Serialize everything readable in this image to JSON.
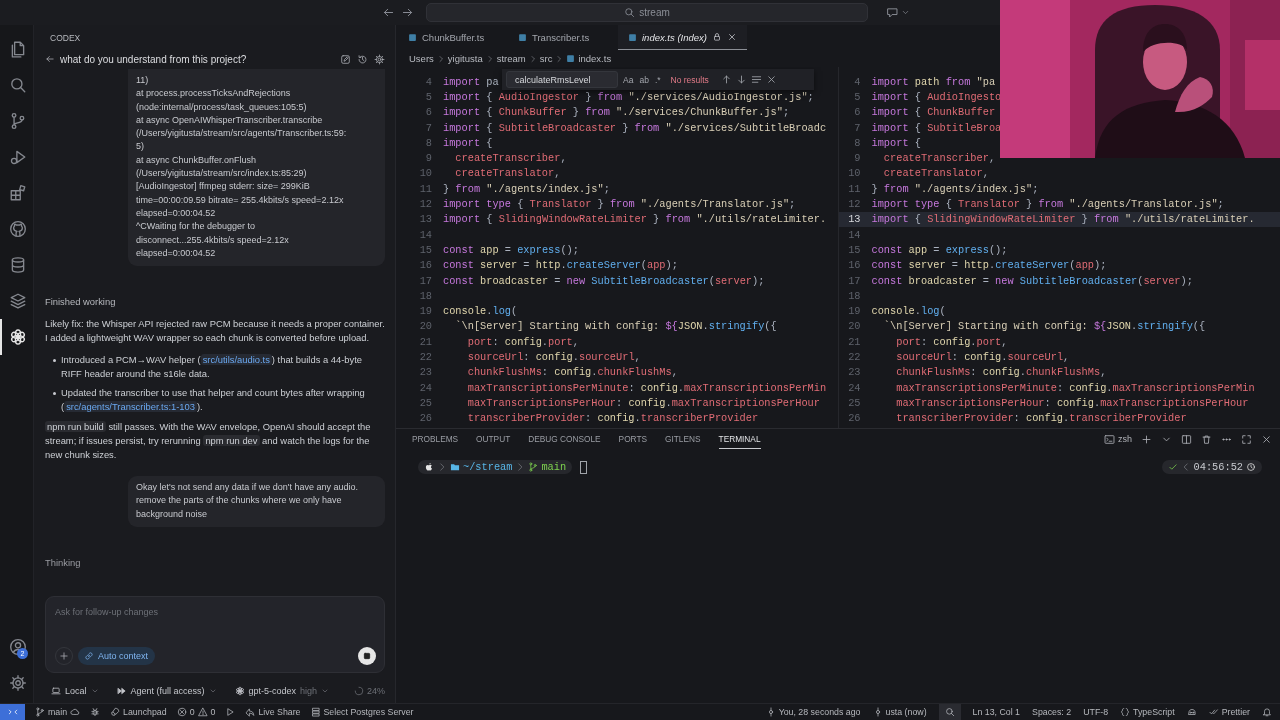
{
  "title_bar": {
    "search": "stream"
  },
  "activity_bar": {
    "items": [
      {
        "kind": "files",
        "selected": false
      },
      {
        "kind": "search",
        "selected": false
      },
      {
        "kind": "scm",
        "selected": false
      },
      {
        "kind": "run",
        "selected": false
      },
      {
        "kind": "extensions",
        "selected": false
      },
      {
        "kind": "github",
        "selected": false
      },
      {
        "kind": "database",
        "selected": false
      },
      {
        "kind": "layers",
        "selected": false
      },
      {
        "kind": "codex",
        "selected": true
      }
    ],
    "account_badge": "2"
  },
  "codex": {
    "heading": "CODEX",
    "thread_title": "what do you understand from this project?",
    "messages": [
      {
        "kind": "user",
        "text": "11)\nat process.processTicksAndRejections\n(node:internal/process/task_queues:105:5)\nat async OpenAIWhisperTranscriber.transcribe\n(/Users/yigitusta/stream/src/agents/Transcriber.ts:59:\n5)\nat async ChunkBuffer.onFlush\n(/Users/yigitusta/stream/src/index.ts:85:29)\n[AudioIngestor] ffmpeg stderr: size= 299KiB\ntime=00:00:09.59 bitrate= 255.4kbits/s speed=2.12x\nelapsed=0:00:04.52\n^CWaiting for the debugger to\ndisconnect...255.4kbits/s speed=2.12x\nelapsed=0:00:04.52"
      },
      {
        "kind": "status",
        "text": "Finished working"
      },
      {
        "kind": "paragraph",
        "segments": [
          {
            "kind": "text",
            "text": "Likely fix: the Whisper API rejected raw PCM because it needs a proper container. I added a lightweight WAV wrapper so each chunk is converted before upload."
          }
        ]
      },
      {
        "kind": "bullets",
        "items": [
          {
            "segments": [
              {
                "kind": "text",
                "text": "Introduced a PCM→WAV helper ("
              },
              {
                "kind": "link",
                "text": "src/utils/audio.ts"
              },
              {
                "kind": "text",
                "text": ") that builds a 44-byte RIFF header around the s16le data."
              }
            ]
          },
          {
            "segments": [
              {
                "kind": "text",
                "text": "Updated the transcriber to use that helper and count bytes after wrapping ("
              },
              {
                "kind": "link",
                "text": "src/agents/Transcriber.ts:1-103"
              },
              {
                "kind": "text",
                "text": ")."
              }
            ]
          }
        ]
      },
      {
        "kind": "paragraph",
        "segments": [
          {
            "kind": "code",
            "text": "npm run build"
          },
          {
            "kind": "text",
            "text": " still passes. With the WAV envelope, OpenAI should accept the stream; if issues persist, try rerunning "
          },
          {
            "kind": "code",
            "text": "npm run dev"
          },
          {
            "kind": "text",
            "text": " and watch the logs for the new chunk sizes."
          }
        ]
      },
      {
        "kind": "user",
        "text": "Okay let's not send any data if we don't have any audio. remove the parts of the chunks where we only have background noise"
      },
      {
        "kind": "thinking",
        "text": "Thinking"
      }
    ],
    "composer": {
      "placeholder": "Ask for follow-up changes",
      "chip": "Auto context"
    },
    "footer": {
      "environment": "Local",
      "mode": "Agent (full access)",
      "model": "gpt-5-codex",
      "effort": "high",
      "usage": "24%"
    }
  },
  "editor": {
    "tabs": [
      {
        "label": "ChunkBuffer.ts",
        "selected": false,
        "preview": false,
        "locked": false
      },
      {
        "label": "Transcriber.ts",
        "selected": false,
        "preview": false,
        "locked": false
      },
      {
        "label": "index.ts (Index)",
        "selected": true,
        "preview": true,
        "locked": true
      }
    ],
    "breadcrumbs": [
      "Users",
      "yigitusta",
      "stream",
      "src",
      "index.ts"
    ],
    "find": {
      "value": "calculateRmsLevel",
      "toggles": [
        "Aa",
        "ab",
        ".*"
      ],
      "result": "No results"
    },
    "panes": [
      {
        "lines": [
          {
            "n": "4",
            "current": false,
            "tokens": [
              {
                "kind": "keyword",
                "text": "import"
              },
              {
                "kind": "plain",
                "text": " pa"
              }
            ]
          },
          {
            "n": "5",
            "current": false,
            "tokens": [
              {
                "kind": "keyword",
                "text": "import"
              },
              {
                "kind": "plain",
                "text": " { "
              },
              {
                "kind": "type",
                "text": "AudioIngestor"
              },
              {
                "kind": "plain",
                "text": " } "
              },
              {
                "kind": "keyword",
                "text": "from"
              },
              {
                "kind": "string",
                "text": " \"./services/AudioIngestor.js\""
              },
              {
                "kind": "plain",
                "text": ";"
              }
            ]
          },
          {
            "n": "6",
            "current": false,
            "tokens": [
              {
                "kind": "keyword",
                "text": "import"
              },
              {
                "kind": "plain",
                "text": " { "
              },
              {
                "kind": "type",
                "text": "ChunkBuffer"
              },
              {
                "kind": "plain",
                "text": " } "
              },
              {
                "kind": "keyword",
                "text": "from"
              },
              {
                "kind": "string",
                "text": " \"./services/ChunkBuffer.js\""
              },
              {
                "kind": "plain",
                "text": ";"
              }
            ]
          },
          {
            "n": "7",
            "current": false,
            "tokens": [
              {
                "kind": "keyword",
                "text": "import"
              },
              {
                "kind": "plain",
                "text": " { "
              },
              {
                "kind": "type",
                "text": "SubtitleBroadcaster"
              },
              {
                "kind": "plain",
                "text": " } "
              },
              {
                "kind": "keyword",
                "text": "from"
              },
              {
                "kind": "string",
                "text": " \"./services/SubtitleBroadc"
              }
            ]
          },
          {
            "n": "8",
            "current": false,
            "tokens": [
              {
                "kind": "keyword",
                "text": "import"
              },
              {
                "kind": "plain",
                "text": " {"
              }
            ]
          },
          {
            "n": "9",
            "current": false,
            "kind": "inner",
            "tokens": [
              {
                "kind": "type",
                "text": "createTranscriber"
              },
              {
                "kind": "plain",
                "text": ","
              }
            ]
          },
          {
            "n": "10",
            "current": false,
            "kind": "inner",
            "tokens": [
              {
                "kind": "type",
                "text": "createTranslator"
              },
              {
                "kind": "plain",
                "text": ","
              }
            ]
          },
          {
            "n": "11",
            "current": false,
            "tokens": [
              {
                "kind": "plain",
                "text": "} "
              },
              {
                "kind": "keyword",
                "text": "from"
              },
              {
                "kind": "string",
                "text": " \"./agents/index.js\""
              },
              {
                "kind": "plain",
                "text": ";"
              }
            ]
          },
          {
            "n": "12",
            "current": false,
            "tokens": [
              {
                "kind": "keyword",
                "text": "import type"
              },
              {
                "kind": "plain",
                "text": " { "
              },
              {
                "kind": "type",
                "text": "Translator"
              },
              {
                "kind": "plain",
                "text": " } "
              },
              {
                "kind": "keyword",
                "text": "from"
              },
              {
                "kind": "string",
                "text": " \"./agents/Translator.js\""
              },
              {
                "kind": "plain",
                "text": ";"
              }
            ]
          },
          {
            "n": "13",
            "current": false,
            "tokens": [
              {
                "kind": "keyword",
                "text": "import"
              },
              {
                "kind": "plain",
                "text": " { "
              },
              {
                "kind": "type",
                "text": "SlidingWindowRateLimiter"
              },
              {
                "kind": "plain",
                "text": " } "
              },
              {
                "kind": "keyword",
                "text": "from"
              },
              {
                "kind": "string",
                "text": " \"./utils/rateLimiter."
              }
            ]
          },
          {
            "n": "14",
            "current": false
          },
          {
            "n": "15",
            "current": false,
            "tokens": [
              {
                "kind": "keyword",
                "text": "const"
              },
              {
                "kind": "variable",
                "text": " app"
              },
              {
                "kind": "plain",
                "text": " = "
              },
              {
                "kind": "function",
                "text": "express"
              },
              {
                "kind": "plain",
                "text": "();"
              }
            ]
          },
          {
            "n": "16",
            "current": false,
            "tokens": [
              {
                "kind": "keyword",
                "text": "const"
              },
              {
                "kind": "variable",
                "text": " server"
              },
              {
                "kind": "plain",
                "text": " = "
              },
              {
                "kind": "variable",
                "text": "http"
              },
              {
                "kind": "plain",
                "text": "."
              },
              {
                "kind": "function",
                "text": "createServer"
              },
              {
                "kind": "plain",
                "text": "("
              },
              {
                "kind": "type",
                "text": "app"
              },
              {
                "kind": "plain",
                "text": ");"
              }
            ]
          },
          {
            "n": "17",
            "current": false,
            "tokens": [
              {
                "kind": "keyword",
                "text": "const"
              },
              {
                "kind": "variable",
                "text": " broadcaster"
              },
              {
                "kind": "plain",
                "text": " = "
              },
              {
                "kind": "keyword",
                "text": "new"
              },
              {
                "kind": "function",
                "text": " SubtitleBroadcaster"
              },
              {
                "kind": "plain",
                "text": "("
              },
              {
                "kind": "type",
                "text": "server"
              },
              {
                "kind": "plain",
                "text": ");"
              }
            ]
          },
          {
            "n": "18",
            "current": false
          },
          {
            "n": "19",
            "current": false,
            "tokens": [
              {
                "kind": "variable",
                "text": "console"
              },
              {
                "kind": "plain",
                "text": "."
              },
              {
                "kind": "function",
                "text": "log"
              },
              {
                "kind": "plain",
                "text": "("
              }
            ]
          },
          {
            "n": "20",
            "current": false,
            "kind": "inner",
            "tokens": [
              {
                "kind": "string",
                "text": "`\\n[Server] Starting with config:"
              },
              {
                "kind": "keyword",
                "text": " ${"
              },
              {
                "kind": "variable",
                "text": "JSON"
              },
              {
                "kind": "plain",
                "text": "."
              },
              {
                "kind": "function",
                "text": "stringify"
              },
              {
                "kind": "plain",
                "text": "({"
              }
            ]
          },
          {
            "n": "21",
            "current": false,
            "kind": "deeper",
            "tokens": [
              {
                "kind": "type",
                "text": "port"
              },
              {
                "kind": "plain",
                "text": ": "
              },
              {
                "kind": "variable",
                "text": "config"
              },
              {
                "kind": "plain",
                "text": "."
              },
              {
                "kind": "type",
                "text": "port"
              },
              {
                "kind": "plain",
                "text": ","
              }
            ]
          },
          {
            "n": "22",
            "current": false,
            "kind": "deeper",
            "tokens": [
              {
                "kind": "type",
                "text": "sourceUrl"
              },
              {
                "kind": "plain",
                "text": ": "
              },
              {
                "kind": "variable",
                "text": "config"
              },
              {
                "kind": "plain",
                "text": "."
              },
              {
                "kind": "type",
                "text": "sourceUrl"
              },
              {
                "kind": "plain",
                "text": ","
              }
            ]
          },
          {
            "n": "23",
            "current": false,
            "kind": "deeper",
            "tokens": [
              {
                "kind": "type",
                "text": "chunkFlushMs"
              },
              {
                "kind": "plain",
                "text": ": "
              },
              {
                "kind": "variable",
                "text": "config"
              },
              {
                "kind": "plain",
                "text": "."
              },
              {
                "kind": "type",
                "text": "chunkFlushMs"
              },
              {
                "kind": "plain",
                "text": ","
              }
            ]
          },
          {
            "n": "24",
            "current": false,
            "kind": "deeper",
            "tokens": [
              {
                "kind": "type",
                "text": "maxTranscriptionsPerMinute"
              },
              {
                "kind": "plain",
                "text": ": "
              },
              {
                "kind": "variable",
                "text": "config"
              },
              {
                "kind": "plain",
                "text": "."
              },
              {
                "kind": "type",
                "text": "maxTranscriptionsPerMin"
              }
            ]
          },
          {
            "n": "25",
            "current": false,
            "kind": "deeper",
            "tokens": [
              {
                "kind": "type",
                "text": "maxTranscriptionsPerHour"
              },
              {
                "kind": "plain",
                "text": ": "
              },
              {
                "kind": "variable",
                "text": "config"
              },
              {
                "kind": "plain",
                "text": "."
              },
              {
                "kind": "type",
                "text": "maxTranscriptionsPerHour"
              }
            ]
          },
          {
            "n": "26",
            "current": false,
            "kind": "deeper",
            "tokens": [
              {
                "kind": "type",
                "text": "transcriberProvider"
              },
              {
                "kind": "plain",
                "text": ": "
              },
              {
                "kind": "variable",
                "text": "config"
              },
              {
                "kind": "plain",
                "text": "."
              },
              {
                "kind": "type",
                "text": "transcriberProvider"
              }
            ]
          }
        ]
      },
      {
        "lines": [
          {
            "n": "4",
            "current": false,
            "tokens": [
              {
                "kind": "keyword",
                "text": "import"
              },
              {
                "kind": "variable",
                "text": " path"
              },
              {
                "kind": "keyword",
                "text": " from"
              },
              {
                "kind": "string",
                "text": " \"pa"
              }
            ]
          },
          {
            "n": "5",
            "current": false,
            "tokens": [
              {
                "kind": "keyword",
                "text": "import"
              },
              {
                "kind": "plain",
                "text": " { "
              },
              {
                "kind": "type",
                "text": "AudioIngesto"
              }
            ]
          },
          {
            "n": "6",
            "current": false,
            "tokens": [
              {
                "kind": "keyword",
                "text": "import"
              },
              {
                "kind": "plain",
                "text": " { "
              },
              {
                "kind": "type",
                "text": "ChunkBuffer"
              }
            ]
          },
          {
            "n": "7",
            "current": false,
            "tokens": [
              {
                "kind": "keyword",
                "text": "import"
              },
              {
                "kind": "plain",
                "text": " { "
              },
              {
                "kind": "type",
                "text": "SubtitleBroa"
              }
            ]
          },
          {
            "n": "8",
            "current": false,
            "tokens": [
              {
                "kind": "keyword",
                "text": "import"
              },
              {
                "kind": "plain",
                "text": " {"
              }
            ]
          },
          {
            "n": "9",
            "current": false,
            "kind": "inner",
            "tokens": [
              {
                "kind": "type",
                "text": "createTranscriber"
              },
              {
                "kind": "plain",
                "text": ","
              }
            ]
          },
          {
            "n": "10",
            "current": false,
            "kind": "inner",
            "tokens": [
              {
                "kind": "type",
                "text": "createTranslator"
              },
              {
                "kind": "plain",
                "text": ","
              }
            ]
          },
          {
            "n": "11",
            "current": false,
            "tokens": [
              {
                "kind": "plain",
                "text": "} "
              },
              {
                "kind": "keyword",
                "text": "from"
              },
              {
                "kind": "string",
                "text": " \"./agents/index.js\""
              },
              {
                "kind": "plain",
                "text": ";"
              }
            ]
          },
          {
            "n": "12",
            "current": false,
            "tokens": [
              {
                "kind": "keyword",
                "text": "import type"
              },
              {
                "kind": "plain",
                "text": " { "
              },
              {
                "kind": "type",
                "text": "Translator"
              },
              {
                "kind": "plain",
                "text": " } "
              },
              {
                "kind": "keyword",
                "text": "from"
              },
              {
                "kind": "string",
                "text": " \"./agents/Translator.js\""
              },
              {
                "kind": "plain",
                "text": ";"
              }
            ]
          },
          {
            "n": "13",
            "current": true,
            "tokens": [
              {
                "kind": "keyword",
                "text": "import"
              },
              {
                "kind": "plain",
                "text": " { "
              },
              {
                "kind": "type",
                "text": "SlidingWindowRateLimiter"
              },
              {
                "kind": "plain",
                "text": " } "
              },
              {
                "kind": "keyword",
                "text": "from"
              },
              {
                "kind": "string",
                "text": " \"./utils/rateLimiter."
              }
            ]
          },
          {
            "n": "14",
            "current": false
          },
          {
            "n": "15",
            "current": false,
            "tokens": [
              {
                "kind": "keyword",
                "text": "const"
              },
              {
                "kind": "variable",
                "text": " app"
              },
              {
                "kind": "plain",
                "text": " = "
              },
              {
                "kind": "function",
                "text": "express"
              },
              {
                "kind": "plain",
                "text": "();"
              }
            ]
          },
          {
            "n": "16",
            "current": false,
            "tokens": [
              {
                "kind": "keyword",
                "text": "const"
              },
              {
                "kind": "variable",
                "text": " server"
              },
              {
                "kind": "plain",
                "text": " = "
              },
              {
                "kind": "variable",
                "text": "http"
              },
              {
                "kind": "plain",
                "text": "."
              },
              {
                "kind": "function",
                "text": "createServer"
              },
              {
                "kind": "plain",
                "text": "("
              },
              {
                "kind": "type",
                "text": "app"
              },
              {
                "kind": "plain",
                "text": ");"
              }
            ]
          },
          {
            "n": "17",
            "current": false,
            "tokens": [
              {
                "kind": "keyword",
                "text": "const"
              },
              {
                "kind": "variable",
                "text": " broadcaster"
              },
              {
                "kind": "plain",
                "text": " = "
              },
              {
                "kind": "keyword",
                "text": "new"
              },
              {
                "kind": "function",
                "text": " SubtitleBroadcaster"
              },
              {
                "kind": "plain",
                "text": "("
              },
              {
                "kind": "type",
                "text": "server"
              },
              {
                "kind": "plain",
                "text": ");"
              }
            ]
          },
          {
            "n": "18",
            "current": false
          },
          {
            "n": "19",
            "current": false,
            "tokens": [
              {
                "kind": "variable",
                "text": "console"
              },
              {
                "kind": "plain",
                "text": "."
              },
              {
                "kind": "function",
                "text": "log"
              },
              {
                "kind": "plain",
                "text": "("
              }
            ]
          },
          {
            "n": "20",
            "current": false,
            "kind": "inner",
            "tokens": [
              {
                "kind": "string",
                "text": "`\\n[Server] Starting with config:"
              },
              {
                "kind": "keyword",
                "text": " ${"
              },
              {
                "kind": "variable",
                "text": "JSON"
              },
              {
                "kind": "plain",
                "text": "."
              },
              {
                "kind": "function",
                "text": "stringify"
              },
              {
                "kind": "plain",
                "text": "({"
              }
            ]
          },
          {
            "n": "21",
            "current": false,
            "kind": "deeper",
            "tokens": [
              {
                "kind": "type",
                "text": "port"
              },
              {
                "kind": "plain",
                "text": ": "
              },
              {
                "kind": "variable",
                "text": "config"
              },
              {
                "kind": "plain",
                "text": "."
              },
              {
                "kind": "type",
                "text": "port"
              },
              {
                "kind": "plain",
                "text": ","
              }
            ]
          },
          {
            "n": "22",
            "current": false,
            "kind": "deeper",
            "tokens": [
              {
                "kind": "type",
                "text": "sourceUrl"
              },
              {
                "kind": "plain",
                "text": ": "
              },
              {
                "kind": "variable",
                "text": "config"
              },
              {
                "kind": "plain",
                "text": "."
              },
              {
                "kind": "type",
                "text": "sourceUrl"
              },
              {
                "kind": "plain",
                "text": ","
              }
            ]
          },
          {
            "n": "23",
            "current": false,
            "kind": "deeper",
            "tokens": [
              {
                "kind": "type",
                "text": "chunkFlushMs"
              },
              {
                "kind": "plain",
                "text": ": "
              },
              {
                "kind": "variable",
                "text": "config"
              },
              {
                "kind": "plain",
                "text": "."
              },
              {
                "kind": "type",
                "text": "chunkFlushMs"
              },
              {
                "kind": "plain",
                "text": ","
              }
            ]
          },
          {
            "n": "24",
            "current": false,
            "kind": "deeper",
            "tokens": [
              {
                "kind": "type",
                "text": "maxTranscriptionsPerMinute"
              },
              {
                "kind": "plain",
                "text": ": "
              },
              {
                "kind": "variable",
                "text": "config"
              },
              {
                "kind": "plain",
                "text": "."
              },
              {
                "kind": "type",
                "text": "maxTranscriptionsPerMin"
              }
            ]
          },
          {
            "n": "25",
            "current": false,
            "kind": "deeper",
            "tokens": [
              {
                "kind": "type",
                "text": "maxTranscriptionsPerHour"
              },
              {
                "kind": "plain",
                "text": ": "
              },
              {
                "kind": "variable",
                "text": "config"
              },
              {
                "kind": "plain",
                "text": "."
              },
              {
                "kind": "type",
                "text": "maxTranscriptionsPerHour"
              }
            ]
          },
          {
            "n": "26",
            "current": false,
            "kind": "deeper",
            "tokens": [
              {
                "kind": "type",
                "text": "transcriberProvider"
              },
              {
                "kind": "plain",
                "text": ": "
              },
              {
                "kind": "variable",
                "text": "config"
              },
              {
                "kind": "plain",
                "text": "."
              },
              {
                "kind": "type",
                "text": "transcriberProvider"
              }
            ]
          }
        ]
      }
    ]
  },
  "panel": {
    "tabs": [
      {
        "label": "PROBLEMS",
        "selected": false
      },
      {
        "label": "OUTPUT",
        "selected": false
      },
      {
        "label": "DEBUG CONSOLE",
        "selected": false
      },
      {
        "label": "PORTS",
        "selected": false
      },
      {
        "label": "GITLENS",
        "selected": false
      },
      {
        "label": "TERMINAL",
        "selected": true
      }
    ],
    "shell": "zsh",
    "prompt": {
      "dir": "~/stream",
      "branch": "main",
      "time": "04:56:52"
    }
  },
  "status_bar": {
    "left": [
      {
        "kind": "remote"
      },
      {
        "kind": "branch",
        "text": "main"
      },
      {
        "kind": "bug"
      },
      {
        "kind": "launchpad",
        "text": "Launchpad"
      },
      {
        "kind": "problems",
        "errors": "0",
        "warnings": "0"
      },
      {
        "kind": "run"
      },
      {
        "kind": "liveshare",
        "text": "Live Share"
      },
      {
        "kind": "postgres",
        "text": "Select Postgres Server"
      }
    ],
    "right": [
      {
        "kind": "blame",
        "text": "You, 28 seconds ago"
      },
      {
        "kind": "author",
        "text": "usta (now)"
      },
      {
        "kind": "zoom"
      },
      {
        "kind": "position",
        "text": "Ln 13, Col 1"
      },
      {
        "kind": "spaces",
        "text": "Spaces: 2"
      },
      {
        "kind": "encoding",
        "text": "UTF-8"
      },
      {
        "kind": "language",
        "text": "TypeScript"
      },
      {
        "kind": "copilot"
      },
      {
        "kind": "prettier",
        "text": "Prettier"
      },
      {
        "kind": "bell"
      }
    ]
  }
}
